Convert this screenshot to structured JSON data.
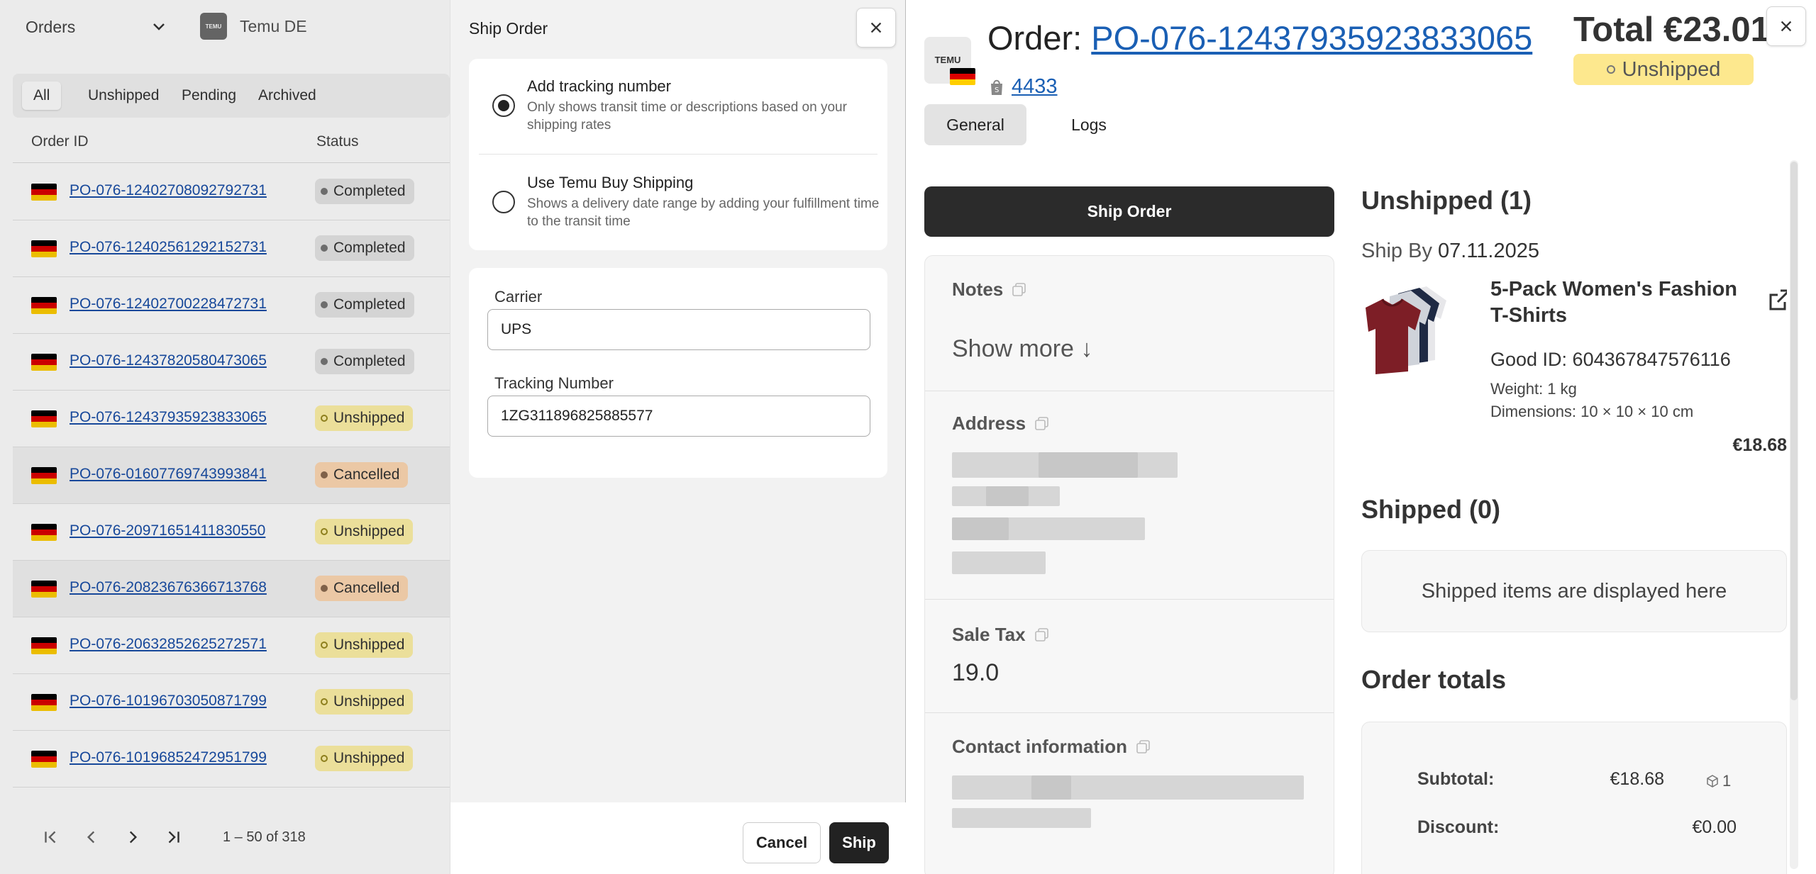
{
  "left": {
    "view_select": "Orders",
    "store_logo": "TEMU",
    "store_name": "Temu DE",
    "filters": [
      "All",
      "Unshipped",
      "Pending",
      "Archived"
    ],
    "columns": {
      "order_id": "Order ID",
      "status": "Status"
    },
    "rows": [
      {
        "id": "PO-076-12402708092792731",
        "status": "Completed",
        "kind": "completed"
      },
      {
        "id": "PO-076-12402561292152731",
        "status": "Completed",
        "kind": "completed"
      },
      {
        "id": "PO-076-12402700228472731",
        "status": "Completed",
        "kind": "completed"
      },
      {
        "id": "PO-076-12437820580473065",
        "status": "Completed",
        "kind": "completed"
      },
      {
        "id": "PO-076-12437935923833065",
        "status": "Unshipped",
        "kind": "unshipped"
      },
      {
        "id": "PO-076-01607769743993841",
        "status": "Cancelled",
        "kind": "cancelled"
      },
      {
        "id": "PO-076-20971651411830550",
        "status": "Unshipped",
        "kind": "unshipped"
      },
      {
        "id": "PO-076-20823676366713768",
        "status": "Cancelled",
        "kind": "cancelled"
      },
      {
        "id": "PO-076-20632852625272571",
        "status": "Unshipped",
        "kind": "unshipped"
      },
      {
        "id": "PO-076-10196703050871799",
        "status": "Unshipped",
        "kind": "unshipped"
      },
      {
        "id": "PO-076-10196852472951799",
        "status": "Unshipped",
        "kind": "unshipped"
      }
    ],
    "pagination": {
      "range": "1 – 50 of 318"
    }
  },
  "ship_panel": {
    "title": "Ship Order",
    "option1": {
      "title": "Add tracking number",
      "desc": "Only shows transit time or descriptions based on your shipping rates",
      "selected": true
    },
    "option2": {
      "title": "Use Temu Buy Shipping",
      "desc": "Shows a delivery date range by adding your fulfillment time to the transit time",
      "selected": false
    },
    "carrier_label": "Carrier",
    "carrier_value": "UPS",
    "tracking_label": "Tracking Number",
    "tracking_value": "1ZG311896825885577",
    "cancel_label": "Cancel",
    "ship_label": "Ship"
  },
  "order": {
    "logo_text": "TEMU",
    "title_prefix": "Order: ",
    "order_id": "PO-076-12437935923833065",
    "shop_number": "4433",
    "total": "Total €23.01",
    "status": "Unshipped",
    "tabs": [
      "General",
      "Logs"
    ],
    "ship_order_label": "Ship Order",
    "notes_label": "Notes",
    "show_more": "Show more ↓",
    "address_label": "Address",
    "sale_tax_label": "Sale Tax",
    "sale_tax_value": "19.0",
    "contact_label": "Contact information",
    "unshipped_heading": "Unshipped (1)",
    "ship_by_label": "Ship By",
    "ship_by_date": "07.11.2025",
    "product": {
      "name": "5-Pack Women's Fashion T-Shirts",
      "good_id": "Good ID: 604367847576116",
      "weight": "Weight: 1 kg",
      "dimensions": "Dimensions: 10 × 10 × 10 cm",
      "price": "€18.68"
    },
    "shipped_heading": "Shipped (0)",
    "shipped_placeholder": "Shipped items are displayed here",
    "totals_heading": "Order totals",
    "subtotal_label": "Subtotal:",
    "subtotal_value": "€18.68",
    "subtotal_qty": "1",
    "discount_label": "Discount:",
    "discount_value": "€0.00"
  },
  "colors": {
    "link": "#1a5fb4",
    "unshipped_badge": "#fde88e",
    "cancelled_badge": "#ffd9b3",
    "completed_badge": "#e6e6e6",
    "primary_button": "#222222"
  }
}
